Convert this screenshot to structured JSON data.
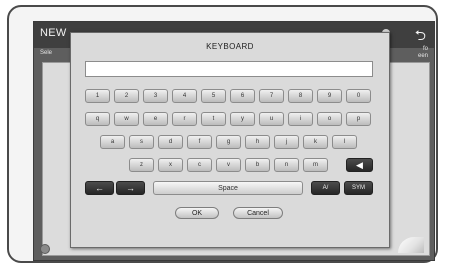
{
  "background": {
    "title": "NEW",
    "sub_left": "Sele",
    "sub_right_1": "fo",
    "sub_right_2": "een"
  },
  "keyboard": {
    "title": "KEYBOARD",
    "input_value": "",
    "row1": [
      "1",
      "2",
      "3",
      "4",
      "5",
      "6",
      "7",
      "8",
      "9",
      "0"
    ],
    "row2": [
      "q",
      "w",
      "e",
      "r",
      "t",
      "y",
      "u",
      "i",
      "o",
      "p"
    ],
    "row3": [
      "a",
      "s",
      "d",
      "f",
      "g",
      "h",
      "j",
      "k",
      "l"
    ],
    "row4": [
      "z",
      "x",
      "c",
      "v",
      "b",
      "n",
      "m"
    ],
    "space_label": "Space",
    "case_label": "A/",
    "sym_label": "SYM",
    "ok_label": "OK",
    "cancel_label": "Cancel"
  },
  "icons": {
    "left": "arrow-left-icon",
    "right": "arrow-right-icon",
    "backspace": "backspace-icon",
    "back": "back-icon"
  },
  "colors": {
    "frame": "#4a4a4a",
    "screen_bg": "#5e5e5e",
    "keyboard_bg": "#dadada",
    "key_light": "#e0e0e0",
    "key_dark": "#333333"
  }
}
